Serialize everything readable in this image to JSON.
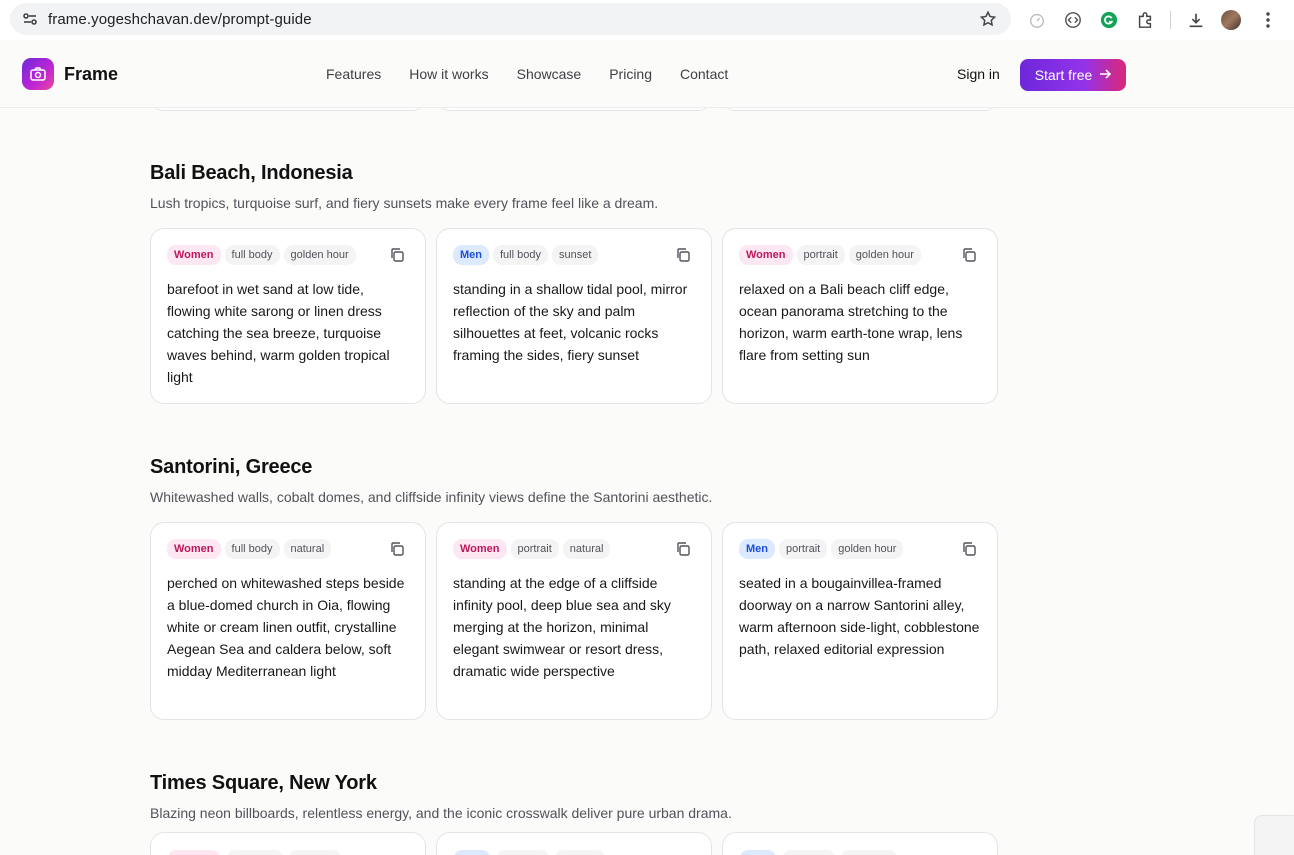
{
  "browser": {
    "url": "frame.yogeshchavan.dev/prompt-guide"
  },
  "nav": {
    "brand": "Frame",
    "links": [
      "Features",
      "How it works",
      "Showcase",
      "Pricing",
      "Contact"
    ],
    "sign_in": "Sign in",
    "cta": "Start free"
  },
  "sections": [
    {
      "title": "Bali Beach, Indonesia",
      "subtitle": "Lush tropics, turquoise surf, and fiery sunsets make every frame feel like a dream.",
      "cards": [
        {
          "tags": [
            {
              "label": "Women",
              "kind": "women"
            },
            {
              "label": "full body",
              "kind": "plain"
            },
            {
              "label": "golden hour",
              "kind": "plain"
            }
          ],
          "text": "barefoot in wet sand at low tide, flowing white sarong or linen dress catching the sea breeze, turquoise waves behind, warm golden tropical light"
        },
        {
          "tags": [
            {
              "label": "Men",
              "kind": "men"
            },
            {
              "label": "full body",
              "kind": "plain"
            },
            {
              "label": "sunset",
              "kind": "plain"
            }
          ],
          "text": "standing in a shallow tidal pool, mirror reflection of the sky and palm silhouettes at feet, volcanic rocks framing the sides, fiery sunset"
        },
        {
          "tags": [
            {
              "label": "Women",
              "kind": "women"
            },
            {
              "label": "portrait",
              "kind": "plain"
            },
            {
              "label": "golden hour",
              "kind": "plain"
            }
          ],
          "text": "relaxed on a Bali beach cliff edge, ocean panorama stretching to the horizon, warm earth-tone wrap, lens flare from setting sun"
        }
      ]
    },
    {
      "title": "Santorini, Greece",
      "subtitle": "Whitewashed walls, cobalt domes, and cliffside infinity views define the Santorini aesthetic.",
      "cards": [
        {
          "tags": [
            {
              "label": "Women",
              "kind": "women"
            },
            {
              "label": "full body",
              "kind": "plain"
            },
            {
              "label": "natural",
              "kind": "plain"
            }
          ],
          "text": "perched on whitewashed steps beside a blue-domed church in Oia, flowing white or cream linen outfit, crystalline Aegean Sea and caldera below, soft midday Mediterranean light"
        },
        {
          "tags": [
            {
              "label": "Women",
              "kind": "women"
            },
            {
              "label": "portrait",
              "kind": "plain"
            },
            {
              "label": "natural",
              "kind": "plain"
            }
          ],
          "text": "standing at the edge of a cliffside infinity pool, deep blue sea and sky merging at the horizon, minimal elegant swimwear or resort dress, dramatic wide perspective"
        },
        {
          "tags": [
            {
              "label": "Men",
              "kind": "men"
            },
            {
              "label": "portrait",
              "kind": "plain"
            },
            {
              "label": "golden hour",
              "kind": "plain"
            }
          ],
          "text": "seated in a bougainvillea-framed doorway on a narrow Santorini alley, warm afternoon side-light, cobblestone path, relaxed editorial expression"
        }
      ]
    },
    {
      "title": "Times Square, New York",
      "subtitle": "Blazing neon billboards, relentless energy, and the iconic crosswalk deliver pure urban drama.",
      "cards": []
    }
  ],
  "colors": {
    "accent_start": "#6d28d9",
    "accent_end": "#db2777",
    "women_tag": "#be185d",
    "men_tag": "#1d4ed8"
  }
}
